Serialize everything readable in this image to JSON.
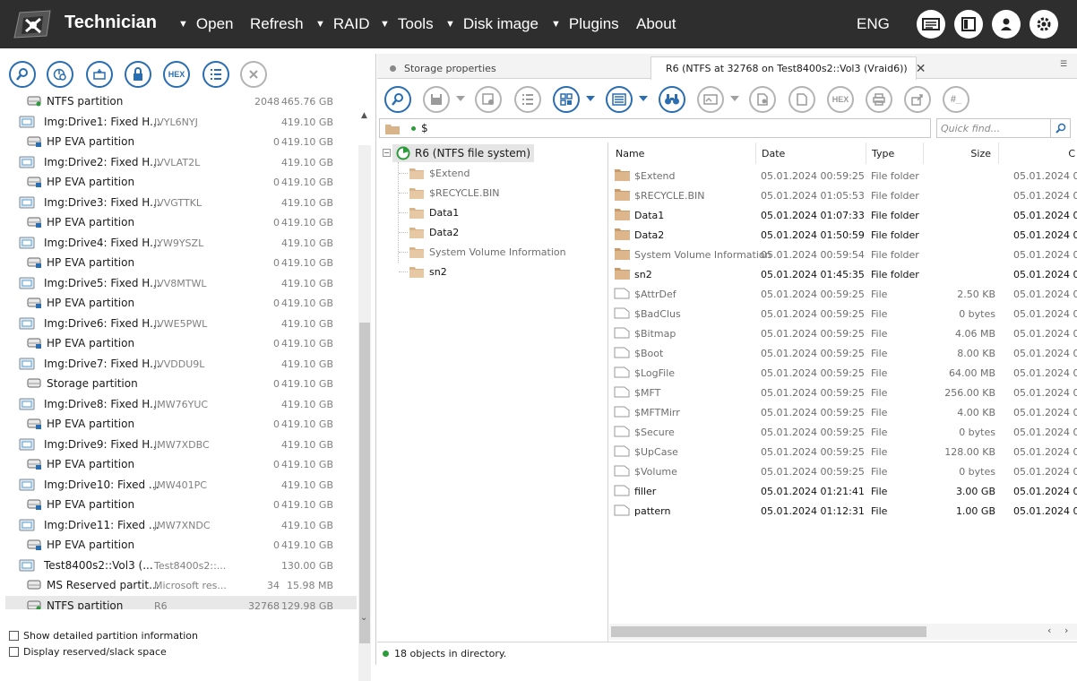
{
  "app": {
    "title": "Technician",
    "lang": "ENG"
  },
  "menu": [
    {
      "label": "Open",
      "dropdown": true
    },
    {
      "label": "Refresh",
      "dropdown": false
    },
    {
      "label": "RAID",
      "dropdown": true
    },
    {
      "label": "Tools",
      "dropdown": true
    },
    {
      "label": "Disk image",
      "dropdown": true
    },
    {
      "label": "Plugins",
      "dropdown": true
    },
    {
      "label": "About",
      "dropdown": false
    }
  ],
  "drives": [
    {
      "name": "NTFS partition",
      "label": "",
      "start": "2048",
      "size": "465.76 GB",
      "kind": "part-green"
    },
    {
      "name": "Img:Drive1: Fixed H...",
      "label": "JVYL6NYJ",
      "start": "",
      "size": "419.10 GB",
      "kind": "disk"
    },
    {
      "name": "HP EVA partition",
      "label": "",
      "start": "0",
      "size": "419.10 GB",
      "kind": "part"
    },
    {
      "name": "Img:Drive2: Fixed H...",
      "label": "JVVLAT2L",
      "start": "",
      "size": "419.10 GB",
      "kind": "disk"
    },
    {
      "name": "HP EVA partition",
      "label": "",
      "start": "0",
      "size": "419.10 GB",
      "kind": "part"
    },
    {
      "name": "Img:Drive3: Fixed H...",
      "label": "JVVGTTKL",
      "start": "",
      "size": "419.10 GB",
      "kind": "disk"
    },
    {
      "name": "HP EVA partition",
      "label": "",
      "start": "0",
      "size": "419.10 GB",
      "kind": "part"
    },
    {
      "name": "Img:Drive4: Fixed H...",
      "label": "JYW9YSZL",
      "start": "",
      "size": "419.10 GB",
      "kind": "disk"
    },
    {
      "name": "HP EVA partition",
      "label": "",
      "start": "0",
      "size": "419.10 GB",
      "kind": "part"
    },
    {
      "name": "Img:Drive5: Fixed H...",
      "label": "JVV8MTWL",
      "start": "",
      "size": "419.10 GB",
      "kind": "disk"
    },
    {
      "name": "HP EVA partition",
      "label": "",
      "start": "0",
      "size": "419.10 GB",
      "kind": "part"
    },
    {
      "name": "Img:Drive6: Fixed H...",
      "label": "JVWE5PWL",
      "start": "",
      "size": "419.10 GB",
      "kind": "disk"
    },
    {
      "name": "HP EVA partition",
      "label": "",
      "start": "0",
      "size": "419.10 GB",
      "kind": "part"
    },
    {
      "name": "Img:Drive7: Fixed H...",
      "label": "JVVDDU9L",
      "start": "",
      "size": "419.10 GB",
      "kind": "disk"
    },
    {
      "name": "Storage partition",
      "label": "",
      "start": "0",
      "size": "419.10 GB",
      "kind": "part-plain"
    },
    {
      "name": "Img:Drive8: Fixed H...",
      "label": "JMW76YUC",
      "start": "",
      "size": "419.10 GB",
      "kind": "disk"
    },
    {
      "name": "HP EVA partition",
      "label": "",
      "start": "0",
      "size": "419.10 GB",
      "kind": "part"
    },
    {
      "name": "Img:Drive9: Fixed H...",
      "label": "JMW7XDBC",
      "start": "",
      "size": "419.10 GB",
      "kind": "disk"
    },
    {
      "name": "HP EVA partition",
      "label": "",
      "start": "0",
      "size": "419.10 GB",
      "kind": "part"
    },
    {
      "name": "Img:Drive10: Fixed ...",
      "label": "JMW401PC",
      "start": "",
      "size": "419.10 GB",
      "kind": "disk"
    },
    {
      "name": "HP EVA partition",
      "label": "",
      "start": "0",
      "size": "419.10 GB",
      "kind": "part"
    },
    {
      "name": "Img:Drive11: Fixed ...",
      "label": "JMW7XNDC",
      "start": "",
      "size": "419.10 GB",
      "kind": "disk"
    },
    {
      "name": "HP EVA partition",
      "label": "",
      "start": "0",
      "size": "419.10 GB",
      "kind": "part"
    },
    {
      "name": "Test8400s2::Vol3 (...",
      "label": "Test8400s2::...",
      "start": "",
      "size": "130.00 GB",
      "kind": "disk"
    },
    {
      "name": "MS Reserved partit...",
      "label": "Microsoft res...",
      "start": "34",
      "size": "15.98 MB",
      "kind": "part-plain"
    },
    {
      "name": "NTFS partition",
      "label": "R6",
      "start": "32768",
      "size": "129.98 GB",
      "kind": "part-green",
      "selected": true
    }
  ],
  "options": {
    "detailed": "Show detailed partition information",
    "reserved": "Display reserved/slack space"
  },
  "tabs": {
    "storage": "Storage properties",
    "fs": "R6 (NTFS at 32768 on Test8400s2::Vol3 (Vraid6))"
  },
  "path": "$",
  "find_placeholder": "Quick find...",
  "tree": {
    "root": "R6 (NTFS file system)",
    "children": [
      "$Extend",
      "$RECYCLE.BIN",
      "Data1",
      "Data2",
      "System Volume Information",
      "sn2"
    ]
  },
  "columns": {
    "name": "Name",
    "date": "Date",
    "type": "Type",
    "size": "Size",
    "extra": "C"
  },
  "files": [
    {
      "name": "$Extend",
      "date": "05.01.2024 00:59:25",
      "type": "File folder",
      "size": "",
      "extra": "05.01.2024 0",
      "folder": true,
      "dim": true
    },
    {
      "name": "$RECYCLE.BIN",
      "date": "05.01.2024 01:05:53",
      "type": "File folder",
      "size": "",
      "extra": "05.01.2024 0",
      "folder": true,
      "dim": true
    },
    {
      "name": "Data1",
      "date": "05.01.2024 01:07:33",
      "type": "File folder",
      "size": "",
      "extra": "05.01.2024 0",
      "folder": true,
      "dim": false
    },
    {
      "name": "Data2",
      "date": "05.01.2024 01:50:59",
      "type": "File folder",
      "size": "",
      "extra": "05.01.2024 0",
      "folder": true,
      "dim": false
    },
    {
      "name": "System Volume Information",
      "date": "05.01.2024 00:59:54",
      "type": "File folder",
      "size": "",
      "extra": "05.01.2024 0",
      "folder": true,
      "dim": true
    },
    {
      "name": "sn2",
      "date": "05.01.2024 01:45:35",
      "type": "File folder",
      "size": "",
      "extra": "05.01.2024 0",
      "folder": true,
      "dim": false
    },
    {
      "name": "$AttrDef",
      "date": "05.01.2024 00:59:25",
      "type": "File",
      "size": "2.50 KB",
      "extra": "05.01.2024 0",
      "folder": false,
      "dim": true
    },
    {
      "name": "$BadClus",
      "date": "05.01.2024 00:59:25",
      "type": "File",
      "size": "0 bytes",
      "extra": "05.01.2024 0",
      "folder": false,
      "dim": true
    },
    {
      "name": "$Bitmap",
      "date": "05.01.2024 00:59:25",
      "type": "File",
      "size": "4.06 MB",
      "extra": "05.01.2024 0",
      "folder": false,
      "dim": true
    },
    {
      "name": "$Boot",
      "date": "05.01.2024 00:59:25",
      "type": "File",
      "size": "8.00 KB",
      "extra": "05.01.2024 0",
      "folder": false,
      "dim": true
    },
    {
      "name": "$LogFile",
      "date": "05.01.2024 00:59:25",
      "type": "File",
      "size": "64.00 MB",
      "extra": "05.01.2024 0",
      "folder": false,
      "dim": true
    },
    {
      "name": "$MFT",
      "date": "05.01.2024 00:59:25",
      "type": "File",
      "size": "256.00 KB",
      "extra": "05.01.2024 0",
      "folder": false,
      "dim": true
    },
    {
      "name": "$MFTMirr",
      "date": "05.01.2024 00:59:25",
      "type": "File",
      "size": "4.00 KB",
      "extra": "05.01.2024 0",
      "folder": false,
      "dim": true
    },
    {
      "name": "$Secure",
      "date": "05.01.2024 00:59:25",
      "type": "File",
      "size": "0 bytes",
      "extra": "05.01.2024 0",
      "folder": false,
      "dim": true
    },
    {
      "name": "$UpCase",
      "date": "05.01.2024 00:59:25",
      "type": "File",
      "size": "128.00 KB",
      "extra": "05.01.2024 0",
      "folder": false,
      "dim": true
    },
    {
      "name": "$Volume",
      "date": "05.01.2024 00:59:25",
      "type": "File",
      "size": "0 bytes",
      "extra": "05.01.2024 0",
      "folder": false,
      "dim": true
    },
    {
      "name": "filler",
      "date": "05.01.2024 01:21:41",
      "type": "File",
      "size": "3.00 GB",
      "extra": "05.01.2024 0",
      "folder": false,
      "dim": false
    },
    {
      "name": "pattern",
      "date": "05.01.2024 01:12:31",
      "type": "File",
      "size": "1.00 GB",
      "extra": "05.01.2024 0",
      "folder": false,
      "dim": false
    }
  ],
  "status": "18 objects in directory.",
  "hex_label": "HEX",
  "hash_label": "#_"
}
